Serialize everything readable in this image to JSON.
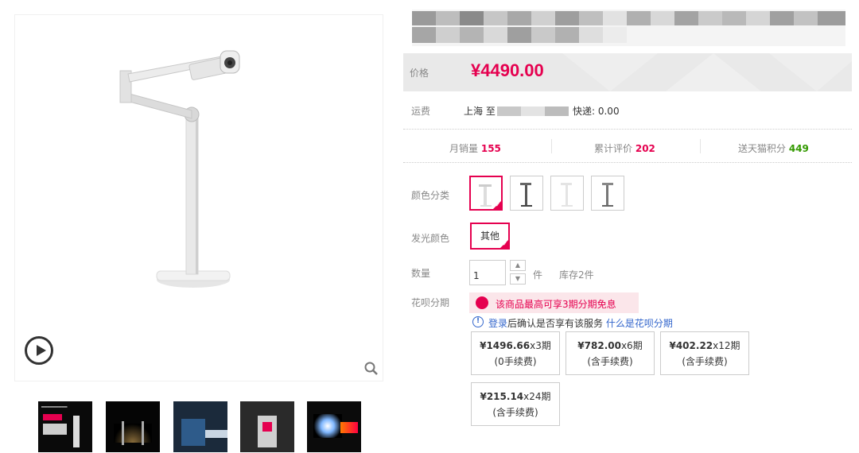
{
  "gallery": {
    "main_alt": "dyson desk lamp product image",
    "thumbnails": [
      {
        "text": "dyson"
      },
      {
        "text": ""
      },
      {
        "text": ""
      },
      {
        "text": ""
      },
      {
        "text": ""
      }
    ]
  },
  "price": {
    "label": "价格",
    "value": "¥4490.00"
  },
  "shipping": {
    "label": "运费",
    "from": "上海 至",
    "express": "快递: 0.00"
  },
  "stats": [
    {
      "label": "月销量",
      "value": "155"
    },
    {
      "label": "累计评价",
      "value": "202"
    },
    {
      "label": "送天猫积分",
      "value": "449"
    }
  ],
  "color": {
    "label": "颜色分类"
  },
  "glow": {
    "label": "发光颜色",
    "option": "其他"
  },
  "quantity": {
    "label": "数量",
    "value": "1",
    "unit": "件",
    "stock": "库存2件"
  },
  "huabei": {
    "label": "花呗分期",
    "banner": "该商品最高可享3期分期免息",
    "login": "登录",
    "confirm": "后确认是否享有该服务",
    "what": "什么是花呗分期",
    "plans": [
      {
        "amount": "¥1496.66",
        "term": "x3期",
        "fee": "(0手续费)"
      },
      {
        "amount": "¥782.00",
        "term": "x6期",
        "fee": "(含手续费)"
      },
      {
        "amount": "¥402.22",
        "term": "x12期",
        "fee": "(含手续费)"
      },
      {
        "amount": "¥215.14",
        "term": "x24期",
        "fee": "(含手续费)"
      }
    ]
  },
  "colors": {
    "accent": "#e5004f",
    "link": "#3366cc",
    "points": "#339900"
  }
}
